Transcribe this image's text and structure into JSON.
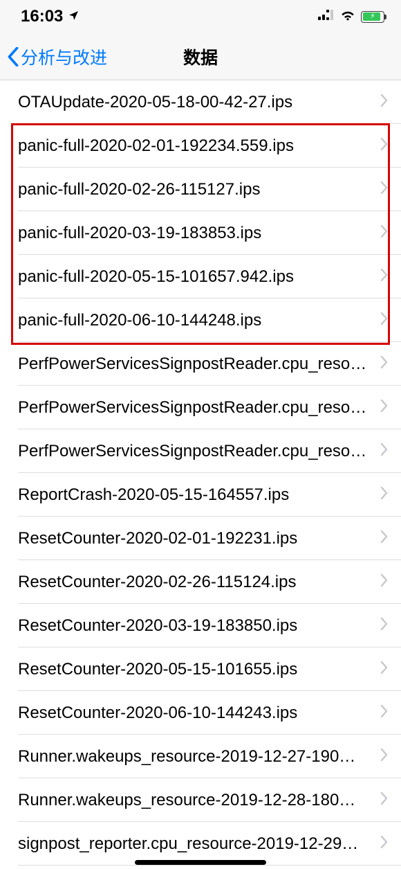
{
  "status": {
    "time": "16:03"
  },
  "nav": {
    "back_label": "分析与改进",
    "title": "数据"
  },
  "rows": [
    {
      "label": "OTAUpdate-2020-05-18-00-42-27.ips"
    },
    {
      "label": "panic-full-2020-02-01-192234.559.ips"
    },
    {
      "label": "panic-full-2020-02-26-115127.ips"
    },
    {
      "label": "panic-full-2020-03-19-183853.ips"
    },
    {
      "label": "panic-full-2020-05-15-101657.942.ips"
    },
    {
      "label": "panic-full-2020-06-10-144248.ips"
    },
    {
      "label": "PerfPowerServicesSignpostReader.cpu_resource-…"
    },
    {
      "label": "PerfPowerServicesSignpostReader.cpu_resource-…"
    },
    {
      "label": "PerfPowerServicesSignpostReader.cpu_resource-…"
    },
    {
      "label": "ReportCrash-2020-05-15-164557.ips"
    },
    {
      "label": "ResetCounter-2020-02-01-192231.ips"
    },
    {
      "label": "ResetCounter-2020-02-26-115124.ips"
    },
    {
      "label": "ResetCounter-2020-03-19-183850.ips"
    },
    {
      "label": "ResetCounter-2020-05-15-101655.ips"
    },
    {
      "label": "ResetCounter-2020-06-10-144243.ips"
    },
    {
      "label": "Runner.wakeups_resource-2019-12-27-190…"
    },
    {
      "label": "Runner.wakeups_resource-2019-12-28-180…"
    },
    {
      "label": "signpost_reporter.cpu_resource-2019-12-29…"
    }
  ],
  "highlight": {
    "start": 1,
    "end": 5
  }
}
